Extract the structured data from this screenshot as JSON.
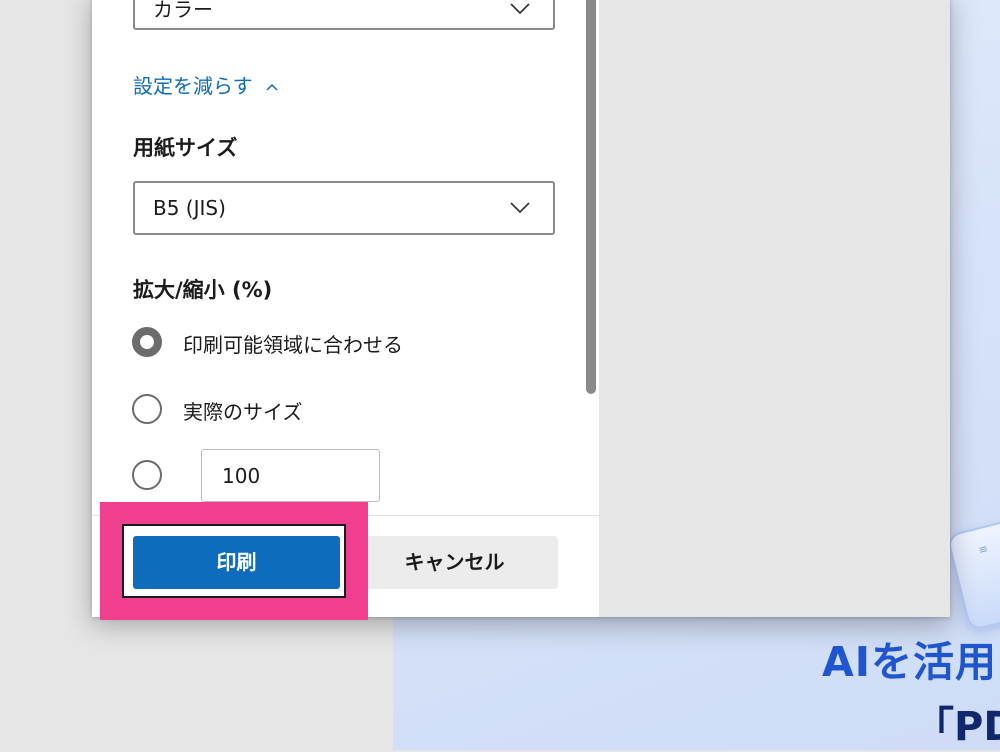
{
  "background_page": {
    "headline": "AIを活用",
    "subline": "「PD",
    "device_icon": "document-lines-icon"
  },
  "print_dialog": {
    "color_select": {
      "value": "カラー",
      "icon": "chevron-down-icon"
    },
    "less_settings_link": {
      "label": "設定を減らす",
      "icon": "chevron-up-icon"
    },
    "paper_size": {
      "label": "用紙サイズ",
      "value": "B5 (JIS)",
      "icon": "chevron-down-icon"
    },
    "scale": {
      "label": "拡大/縮小 (%)",
      "options": [
        {
          "label": "印刷可能領域に合わせる",
          "selected": true
        },
        {
          "label": "実際のサイズ",
          "selected": false
        },
        {
          "label": "",
          "selected": false
        }
      ],
      "custom_value": "100"
    },
    "buttons": {
      "print": "印刷",
      "cancel": "キャンセル"
    }
  },
  "colors": {
    "accent": "#0f6cbd",
    "highlight": "#ef3f8e",
    "headline": "#1f55cf"
  }
}
